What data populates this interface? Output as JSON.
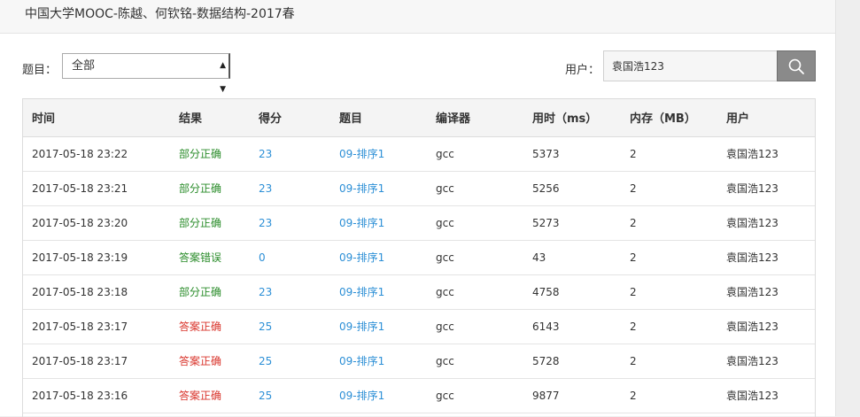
{
  "header": {
    "title": "中国大学MOOC-陈越、何钦铭-数据结构-2017春"
  },
  "filters": {
    "problem_label": "题目：",
    "problem_selected": "全部",
    "user_label": "用户：",
    "user_value": "袁国浩123"
  },
  "table": {
    "columns": [
      "时间",
      "结果",
      "得分",
      "题目",
      "编译器",
      "用时（ms）",
      "内存（MB）",
      "用户"
    ],
    "rows": [
      {
        "time": "2017-05-18 23:22",
        "result": "部分正确",
        "result_type": "partial",
        "score": "23",
        "problem": "09-排序1",
        "compiler": "gcc",
        "time_ms": "5373",
        "memory": "2",
        "user": "袁国浩123"
      },
      {
        "time": "2017-05-18 23:21",
        "result": "部分正确",
        "result_type": "partial",
        "score": "23",
        "problem": "09-排序1",
        "compiler": "gcc",
        "time_ms": "5256",
        "memory": "2",
        "user": "袁国浩123"
      },
      {
        "time": "2017-05-18 23:20",
        "result": "部分正确",
        "result_type": "partial",
        "score": "23",
        "problem": "09-排序1",
        "compiler": "gcc",
        "time_ms": "5273",
        "memory": "2",
        "user": "袁国浩123"
      },
      {
        "time": "2017-05-18 23:19",
        "result": "答案错误",
        "result_type": "wrong",
        "score": "0",
        "problem": "09-排序1",
        "compiler": "gcc",
        "time_ms": "43",
        "memory": "2",
        "user": "袁国浩123"
      },
      {
        "time": "2017-05-18 23:18",
        "result": "部分正确",
        "result_type": "partial",
        "score": "23",
        "problem": "09-排序1",
        "compiler": "gcc",
        "time_ms": "4758",
        "memory": "2",
        "user": "袁国浩123"
      },
      {
        "time": "2017-05-18 23:17",
        "result": "答案正确",
        "result_type": "correct",
        "score": "25",
        "problem": "09-排序1",
        "compiler": "gcc",
        "time_ms": "6143",
        "memory": "2",
        "user": "袁国浩123"
      },
      {
        "time": "2017-05-18 23:17",
        "result": "答案正确",
        "result_type": "correct",
        "score": "25",
        "problem": "09-排序1",
        "compiler": "gcc",
        "time_ms": "5728",
        "memory": "2",
        "user": "袁国浩123"
      },
      {
        "time": "2017-05-18 23:16",
        "result": "答案正确",
        "result_type": "correct",
        "score": "25",
        "problem": "09-排序1",
        "compiler": "gcc",
        "time_ms": "9877",
        "memory": "2",
        "user": "袁国浩123"
      }
    ]
  },
  "colors": {
    "partial": "#2a8c2a",
    "wrong": "#2a8c2a",
    "correct": "#d9342b",
    "link": "#2c8fd6"
  },
  "icons": {
    "search": "search-icon",
    "dropdown": "dropdown-arrow-icon"
  }
}
